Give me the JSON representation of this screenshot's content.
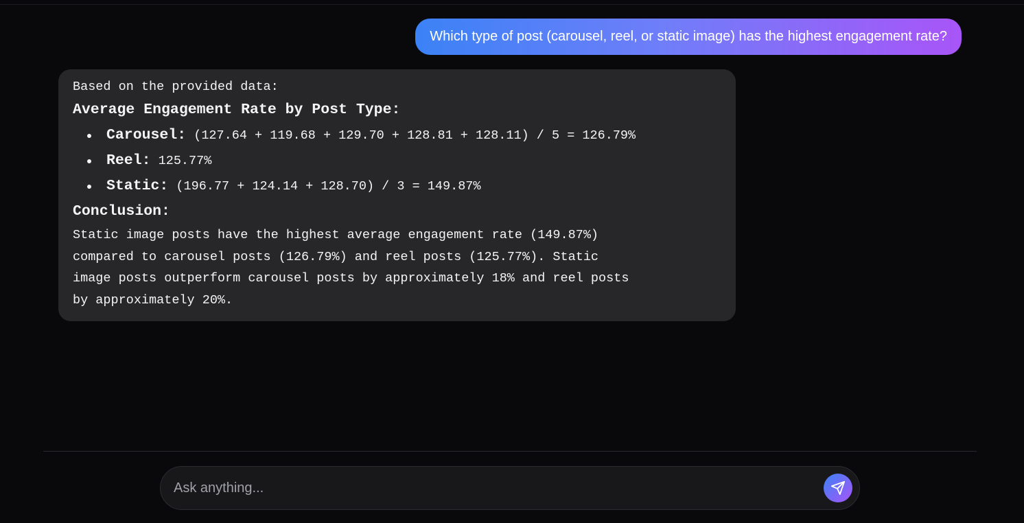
{
  "user_message": {
    "text": "Which type of post (carousel, reel, or static image) has the highest engagement rate?"
  },
  "assistant_message": {
    "intro": "Based on the provided data:",
    "heading": "Average Engagement Rate by Post Type:",
    "bullets": [
      {
        "term": "Carousel:",
        "detail": " (127.64 + 119.68 + 129.70 + 128.81 + 128.11) / 5 = 126.79%"
      },
      {
        "term": "Reel:",
        "detail": " 125.77%"
      },
      {
        "term": "Static:",
        "detail": " (196.77 + 124.14 + 128.70) / 3 = 149.87%"
      }
    ],
    "conclusion_heading": "Conclusion:",
    "conclusion_text": "Static image posts have the highest average engagement rate (149.87%)\ncompared to carousel posts (126.79%) and reel posts (125.77%). Static\nimage posts outperform carousel posts by approximately 18% and reel posts\nby approximately 20%."
  },
  "composer": {
    "placeholder": "Ask anything...",
    "value": "",
    "send_icon": "send-paper-plane-icon"
  },
  "colors": {
    "background": "#09090b",
    "assistant_bubble": "#27272a",
    "user_gradient_start": "#3b82f6",
    "user_gradient_end": "#a855f7"
  }
}
